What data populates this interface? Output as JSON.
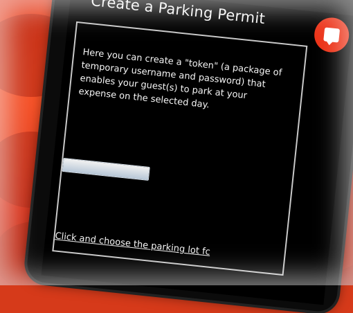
{
  "app": {
    "title": "Create a Parking Permit",
    "badge_icon": "chat-bubble-icon"
  },
  "panel": {
    "description": "Here you can create a \"token\" (a package of temporary username and password) that enables your guest(s) to park at your expense on the selected day.",
    "token_input_value": "",
    "choose_lot_link": "Click and choose the parking lot fc"
  },
  "colors": {
    "accent": "#ec3318",
    "background": "#d63a1a",
    "screen": "#000000",
    "text": "#f4f4f4"
  }
}
